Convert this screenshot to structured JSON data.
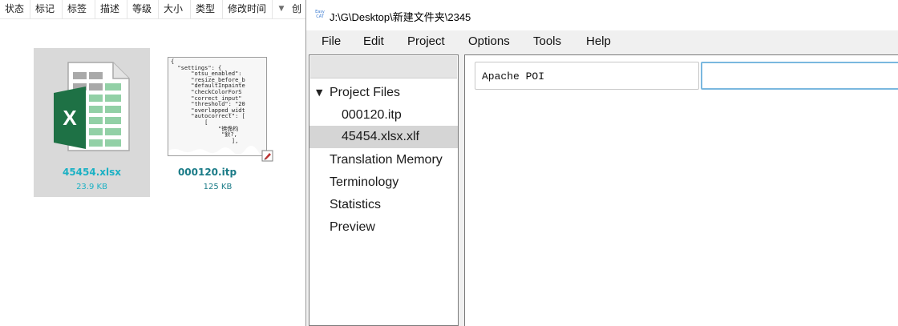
{
  "explorer": {
    "columns": [
      "状态",
      "标记",
      "标签",
      "描述",
      "等级",
      "大小",
      "类型",
      "修改时间"
    ],
    "partial_column": "创",
    "files": [
      {
        "name": "45454.xlsx",
        "size": "23.9 KB",
        "icon": "excel-file-icon"
      },
      {
        "name": "000120.itp",
        "size": "125 KB",
        "icon": "json-document-thumbnail"
      }
    ],
    "thumbnail_text": "{\n  \"settings\": {\n      \"otsu_enabled\":\n      \"resize_before_b\n      \"defaultInpainte\n      \"checkColorForS\n      \"correct_input\"\n      \"threshold\": \"20\n      \"overlapped_widt\n      \"autocorrect\": [\n          [\n              \"锛佹枃\n               \"鈥?,\n                  ],"
  },
  "app": {
    "logo_text": "Easy CAT",
    "title": "J:\\G\\Desktop\\新建文件夹\\2345",
    "menu": [
      "File",
      "Edit",
      "Project",
      "Options",
      "Tools",
      "Help"
    ],
    "tree": {
      "root_label": "Project Files",
      "files": [
        "000120.itp",
        "45454.xlsx.xlf"
      ],
      "selected_index": 1,
      "sections": [
        "Translation Memory",
        "Terminology",
        "Statistics",
        "Preview"
      ]
    },
    "editor": {
      "source_value": "Apache POI",
      "target_value": ""
    }
  },
  "colors": {
    "excel_green": "#1e7145",
    "excel_light_green": "#92d0a6",
    "file_name_cyan": "#1bb1c4",
    "file_name_teal": "#1a7b87",
    "focus_border": "#7ab8df"
  }
}
